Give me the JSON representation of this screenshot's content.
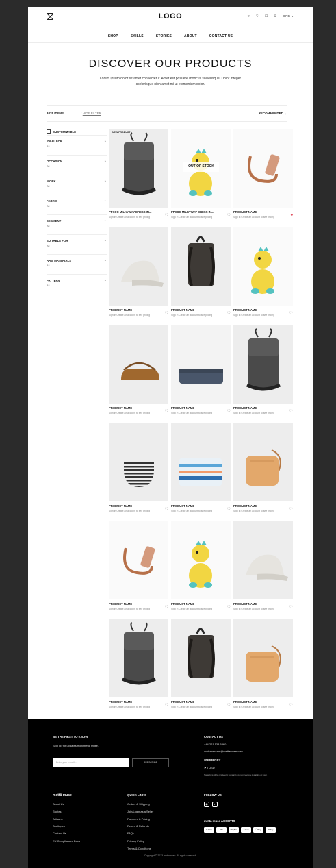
{
  "header": {
    "logo": "LOGO",
    "icons": [
      "search-icon",
      "heart-icon",
      "bag-icon",
      "user-icon"
    ],
    "language": "ENG ⌄",
    "nav": [
      "SHOP",
      "SKILLS",
      "STORIES",
      "ABOUT",
      "CONTACT US"
    ]
  },
  "hero": {
    "title": "DISCOVER OUR PRODUCTS",
    "subtitle": "Lorem ipsum dolor sit amet consectetur. Amet est posuere rhoncus scelerisque. Dolor integer scelerisque nibh amet mi ut elementum dolor."
  },
  "toolbar": {
    "items": "3425 ITEMS",
    "hide_filter": "HIDE FILTER",
    "sort": "RECOMMENDED"
  },
  "filters": {
    "customizable": "CUSTOMIZABLE",
    "groups": [
      {
        "title": "IDEAL FOR",
        "value": "All"
      },
      {
        "title": "OCCASION",
        "value": "All"
      },
      {
        "title": "WORK",
        "value": "All"
      },
      {
        "title": "FABRIC",
        "value": "All"
      },
      {
        "title": "SEGMENT",
        "value": "All"
      },
      {
        "title": "SUITABLE FOR",
        "value": "All"
      },
      {
        "title": "RAW MATERIALS",
        "value": "All"
      },
      {
        "title": "PATTERN",
        "value": "All"
      }
    ]
  },
  "products": [
    {
      "name": "PPXOC MILKYWAY DRESS IN...",
      "kind": "backpack",
      "badge": "NEW PRODUCT",
      "liked": false
    },
    {
      "name": "PPXOC MILKYWAY DRESS IN...",
      "kind": "toy",
      "overlay": "OUT OF STOCK",
      "liked": false
    },
    {
      "name": "PRODUCT NAME",
      "kind": "strap",
      "liked": true
    },
    {
      "name": "PRODUCT NAME",
      "kind": "cap",
      "liked": false
    },
    {
      "name": "PRODUCT NAME",
      "kind": "backpack-back",
      "liked": false
    },
    {
      "name": "PRODUCT NAME",
      "kind": "toy",
      "liked": false
    },
    {
      "name": "PRODUCT NAME",
      "kind": "brown-bag",
      "liked": false
    },
    {
      "name": "PRODUCT NAME",
      "kind": "blue-bag",
      "liked": false
    },
    {
      "name": "PRODUCT NAME",
      "kind": "backpack",
      "liked": false
    },
    {
      "name": "PRODUCT NAME",
      "kind": "stripe-pouch",
      "liked": false
    },
    {
      "name": "PRODUCT NAME",
      "kind": "color-pouch",
      "liked": false
    },
    {
      "name": "PRODUCT NAME",
      "kind": "tan-bag",
      "liked": false
    },
    {
      "name": "PRODUCT NAME",
      "kind": "strap",
      "liked": false
    },
    {
      "name": "PRODUCT NAME",
      "kind": "toy",
      "liked": false
    },
    {
      "name": "PRODUCT NAME",
      "kind": "cap",
      "liked": false
    },
    {
      "name": "PRODUCT NAME",
      "kind": "backpack",
      "liked": false
    },
    {
      "name": "PRODUCT NAME",
      "kind": "backpack-back",
      "liked": false
    },
    {
      "name": "PRODUCT NAME",
      "kind": "tan-bag",
      "liked": false
    }
  ],
  "product_sign_link": "Sign in",
  "product_sign_text": " Create an account to see pricing",
  "footer": {
    "newsletter_title": "BE THE FIRST TO KNOW",
    "newsletter_text": "Sign up for updates from mettā muse.",
    "email_placeholder": "Enter your e-mail...",
    "subscribe": "SUBSCRIBE",
    "contact_title": "CONTACT US",
    "phone": "+44 221 133 5360",
    "email": "customercare@mettamuse.com",
    "currency_title": "CURRENCY",
    "currency": "• USD",
    "currency_note": "Transactions will be completed in Euros and a currency reference is available on hover.",
    "brand_title": "mettā muse",
    "brand_links": [
      "About Us",
      "Stories",
      "Artisans",
      "Boutiques",
      "Contact Us",
      "EU Compliances Docs"
    ],
    "quick_title": "QUICK LINKS",
    "quick_links": [
      "Orders & Shipping",
      "Join/Login as a Seller",
      "Payment & Pricing",
      "Return & Refunds",
      "FAQs",
      "Privacy Policy",
      "Terms & Conditions"
    ],
    "follow_title": "FOLLOW US",
    "social": [
      "instagram-icon",
      "linkedin-icon"
    ],
    "accepts_title": "mettā muse ACCEPTS",
    "payments": [
      "G Pay",
      "MC",
      "PayPal",
      "Amex",
      " Pay",
      "OPay"
    ],
    "copyright": "Copyright © 2023 mettamuse. All rights reserved."
  }
}
